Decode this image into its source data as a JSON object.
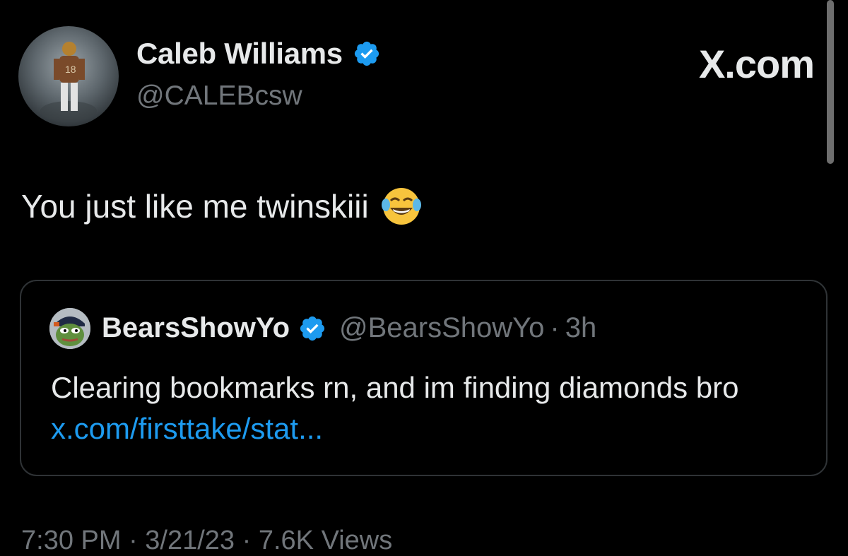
{
  "author": {
    "name": "Caleb Williams",
    "handle": "@CALEBcsw"
  },
  "brand": "X.com",
  "tweet": {
    "text": "You just like me twinskiii",
    "emoji": "face-with-tears-of-joy"
  },
  "quoted": {
    "name": "BearsShowYo",
    "handle": "@BearsShowYo",
    "separator": "·",
    "time": "3h",
    "text": "Clearing bookmarks rn, and im finding diamonds bro ",
    "link": "x.com/firsttake/stat..."
  },
  "footer": {
    "meta": "7:30 PM · 3/21/23 · 7.6K Views"
  },
  "colors": {
    "background": "#000000",
    "primary_text": "#e7e9ea",
    "secondary_text": "#71767b",
    "link": "#1d9bf0",
    "verified_badge": "#1d9bf0",
    "border": "#2f3336"
  }
}
